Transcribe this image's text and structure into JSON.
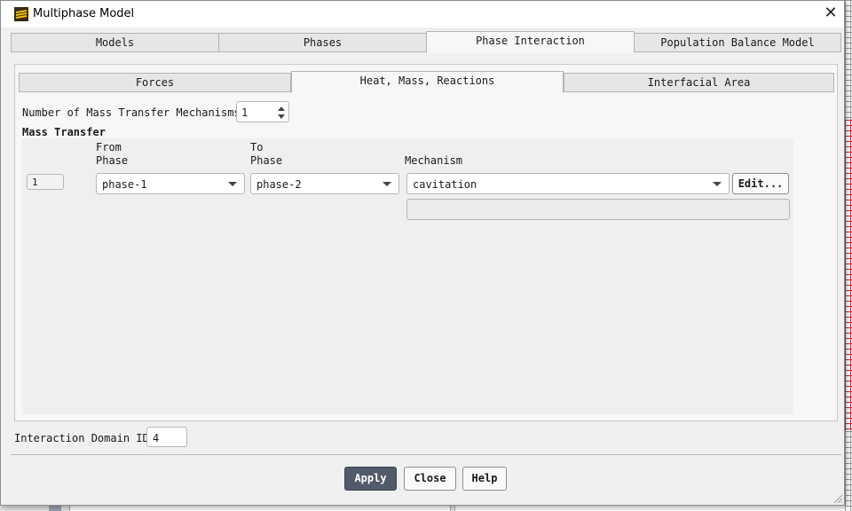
{
  "dialog": {
    "title": "Multiphase Model",
    "close_glyph": "✕"
  },
  "main_tabs": [
    {
      "label": "Models",
      "active": false
    },
    {
      "label": "Phases",
      "active": false
    },
    {
      "label": "Phase Interaction",
      "active": true
    },
    {
      "label": "Population Balance Model",
      "active": false
    }
  ],
  "sub_tabs": [
    {
      "label": "Forces",
      "active": false
    },
    {
      "label": "Heat, Mass, Reactions",
      "active": true
    },
    {
      "label": "Interfacial Area",
      "active": false
    }
  ],
  "mass_transfer": {
    "count_label": "Number of Mass Transfer Mechanisms",
    "count_value": "1",
    "group_title": "Mass Transfer",
    "headers": {
      "from_line1": "From",
      "from_line2": "Phase",
      "to_line1": "To",
      "to_line2": "Phase",
      "mechanism": "Mechanism"
    },
    "rows": [
      {
        "index": "1",
        "from_phase": "phase-1",
        "to_phase": "phase-2",
        "mechanism": "cavitation",
        "edit_label": "Edit..."
      }
    ]
  },
  "interaction_domain": {
    "label": "Interaction Domain ID",
    "value": "4"
  },
  "buttons": {
    "apply": "Apply",
    "close": "Close",
    "help": "Help"
  },
  "icons": {
    "app": "ansys-fluent-icon",
    "spin_up": "spin-up-icon",
    "spin_down": "spin-down-icon",
    "dropdown": "chevron-down-icon"
  },
  "colors": {
    "primary_button": "#515a69",
    "dialog_bg": "#f0f0f0",
    "active_tab": "#f7f7f7"
  }
}
